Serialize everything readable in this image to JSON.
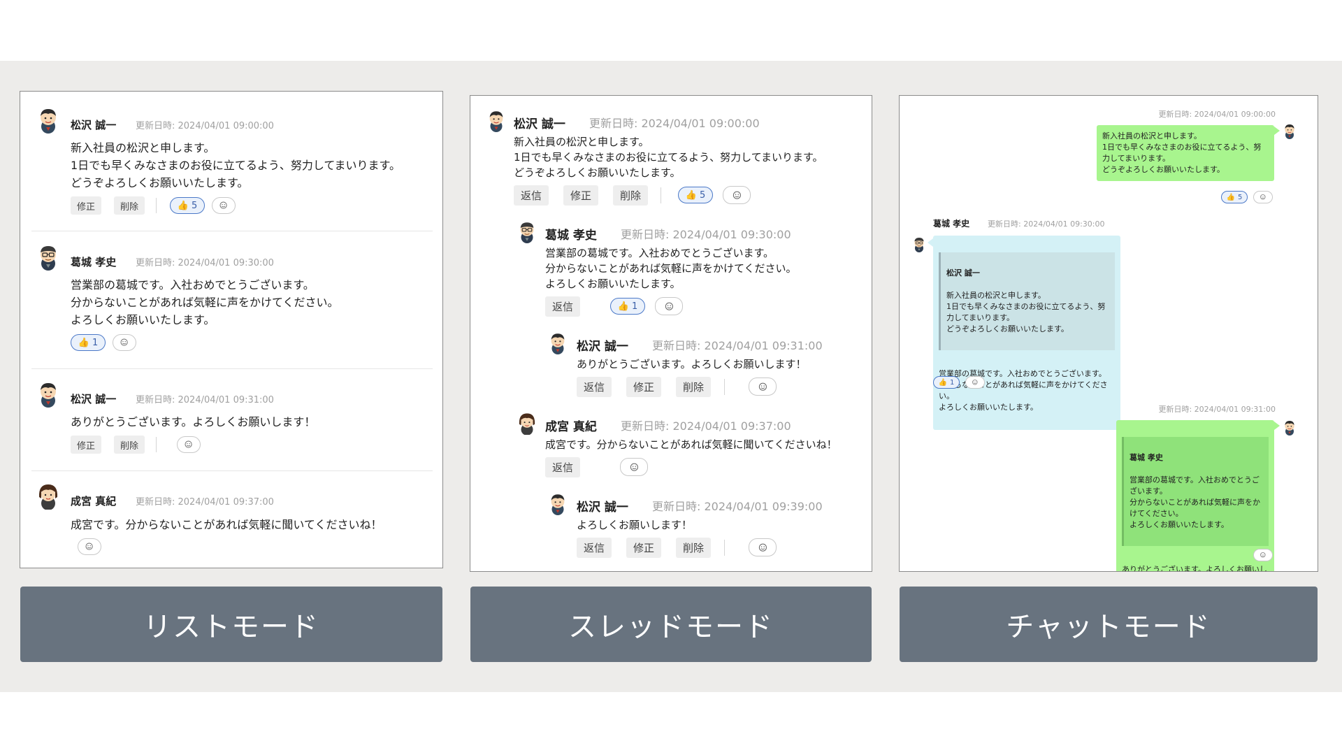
{
  "modes": {
    "list_label": "リストモード",
    "thread_label": "スレッドモード",
    "chat_label": "チャットモード"
  },
  "labels": {
    "edit": "修正",
    "delete": "削除",
    "reply": "返信"
  },
  "messages": [
    {
      "author": "松沢 誠一",
      "updated": "更新日時: 2024/04/01 09:00:00",
      "text": "新入社員の松沢と申します。\n1日でも早くみなさまのお役に立てるよう、努力してまいります。\nどうぞよろしくお願いいたします。",
      "reaction": "5"
    },
    {
      "author": "葛城 孝史",
      "updated": "更新日時: 2024/04/01 09:30:00",
      "text": "営業部の葛城です。入社おめでとうございます。\n分からないことがあれば気軽に声をかけてください。\nよろしくお願いいたします。",
      "reaction": "1"
    },
    {
      "author": "松沢 誠一",
      "updated": "更新日時: 2024/04/01 09:31:00",
      "text": "ありがとうございます。よろしくお願いします！"
    },
    {
      "author": "成宮 真紀",
      "updated": "更新日時: 2024/04/01 09:37:00",
      "text": "成宮です。分からないことがあれば気軽に聞いてくださいね！"
    },
    {
      "author": "松沢 誠一",
      "updated": "更新日時: 2024/04/01 09:39:00",
      "text": "よろしくお願いします！"
    }
  ],
  "chat": {
    "msg1": "新入社員の松沢と申します。\n1日でも早くみなさまのお役に立てるよう、努\n力してまいります。\nどうぞよろしくお願いいたします。",
    "quote1": "新入社員の松沢と申します。\n1日でも早くみなさまのお役に立てるよう、努\n力してまいります。\nどうぞよろしくお願いいたします。",
    "msg2": "営業部の葛城です。入社おめでとうございます。\n分からないことがあれば気軽に声をかけてくださ\nい。\nよろしくお願いいたします。",
    "quote2": "営業部の葛城です。入社おめでとうご\nざいます。\n分からないことがあれば気軽に声をか\nけてください。\nよろしくお願いいたします。",
    "msg3": "ありがとうございます。よろしくお願いし\nます！"
  },
  "icons": {
    "thumbs_up": "👍",
    "emoji_add": "smile-add-icon"
  }
}
